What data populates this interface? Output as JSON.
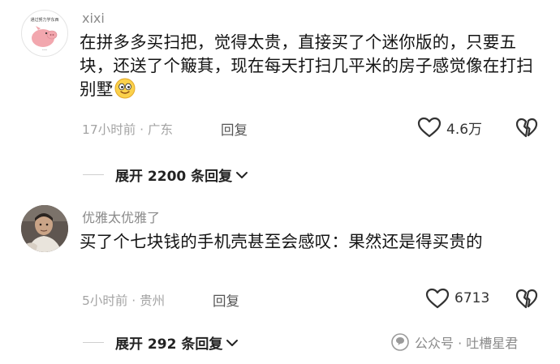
{
  "comments": [
    {
      "username": "xixi",
      "avatar_caption": "通过努力学东西",
      "avatar_icon": "pink-pig-icon",
      "text": "在拼多多买扫把，觉得太贵，直接买了个迷你版的，只要五块，还送了个簸萁，现在每天打扫几平米的房子感觉像在打扫别墅",
      "emoji": "grinning-face-icon",
      "time_location": "17小时前 · 广东",
      "reply_label": "回复",
      "likes": "4.6万",
      "expand_label": "展开 2200 条回复"
    },
    {
      "username": "优雅太优雅了",
      "text": "买了个七块钱的手机壳甚至会感叹：果然还是得买贵的",
      "time_location": "5小时前 · 贵州",
      "reply_label": "回复",
      "likes": "6713",
      "expand_label": "展开 292 条回复"
    }
  ],
  "watermark": {
    "text": "公众号 · 吐槽星君",
    "icon": "wechat-official-account-icon"
  },
  "colors": {
    "text": "#141414",
    "muted": "#a4a4a4",
    "username": "#8a8a8a"
  }
}
